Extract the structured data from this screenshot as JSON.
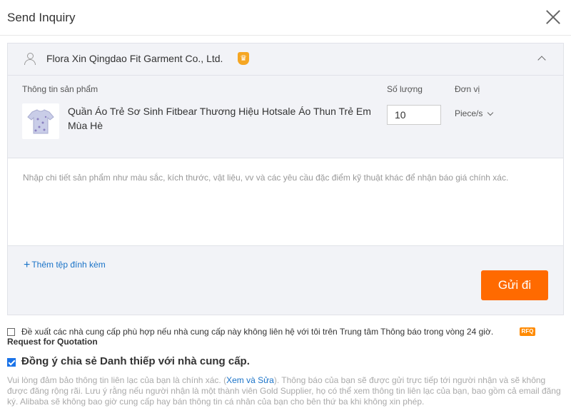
{
  "dialog": {
    "title": "Send Inquiry"
  },
  "supplier": {
    "name": "Flora Xin Qingdao Fit Garment Co., Ltd.",
    "badge": "♛"
  },
  "columns": {
    "product_info": "Thông tin sản phẩm",
    "quantity": "Số lượng",
    "unit": "Đơn vị"
  },
  "product": {
    "name": "Quần Áo Trẻ Sơ Sinh Fitbear Thương Hiệu Hotsale Áo Thun Trẻ Em Mùa Hè",
    "quantity": "10",
    "unit": "Piece/s"
  },
  "details": {
    "placeholder": "Nhập chi tiết sản phẩm như màu sắc, kích thước, vật liệu, vv và các yêu cầu đặc điểm kỹ thuật khác để nhận báo giá chính xác."
  },
  "attach": {
    "plus": "+",
    "label": "Thêm tệp đính kèm"
  },
  "send_button": "Gửi đi",
  "recommend": {
    "text": "Đề xuất các nhà cung cấp phù hợp nếu nhà cung cấp này không liên hệ với tôi trên Trung tâm Thông báo trong vòng 24 giờ.",
    "badge": "RFQ",
    "rfq_label": "Request for Quotation",
    "checked": false
  },
  "share_card": {
    "text": "Đồng ý chia sẻ Danh thiếp với nhà cung cấp.",
    "checked": true
  },
  "notice": {
    "before_link": "Vui lòng đảm bảo thông tin liên lạc của bạn là chính xác. (",
    "link": "Xem và Sửa",
    "after_link": "). Thông báo của bạn sẽ được gửi trực tiếp tới người nhận và sẽ không được đăng rộng rãi. Lưu ý rằng nếu người nhận là một thành viên Gold Supplier, họ có thể xem thông tin liên lạc của bạn, bao gồm cả email đăng ký. Alibaba sẽ không bao giờ cung cấp hay bán thông tin cá nhân của bạn cho bên thứ ba khi không xin phép."
  },
  "colors": {
    "accent": "#ff6a00",
    "link": "#1a73c8",
    "panel_bg": "#f2f3f7",
    "gold": "#f5a623"
  }
}
